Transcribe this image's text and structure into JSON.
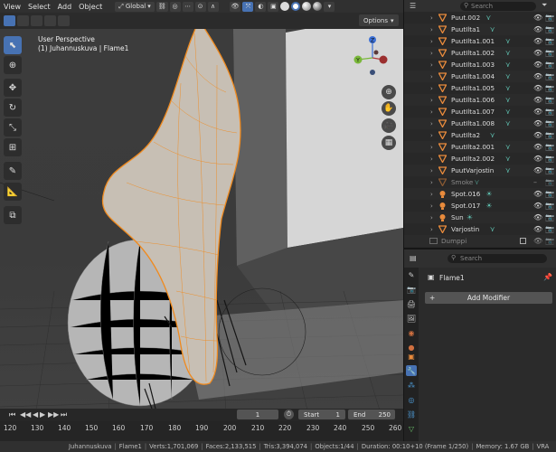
{
  "header": {
    "menus": [
      "View",
      "Select",
      "Add",
      "Object"
    ],
    "orientation": "Global",
    "options_label": "Options"
  },
  "viewport": {
    "perspective": "User Perspective",
    "context": "(1) Juhannuskuva | Flame1",
    "gizmo": {
      "z": "Z",
      "y": "Y"
    }
  },
  "outliner": {
    "search_placeholder": "Search",
    "rows": [
      {
        "name": "Puut.002",
        "type": "mesh",
        "mod": true
      },
      {
        "name": "PuutIlta1",
        "type": "mesh",
        "mod": true
      },
      {
        "name": "PuutIlta1.001",
        "type": "mesh",
        "mod": true
      },
      {
        "name": "PuutIlta1.002",
        "type": "mesh",
        "mod": true
      },
      {
        "name": "PuutIlta1.003",
        "type": "mesh",
        "mod": true
      },
      {
        "name": "PuutIlta1.004",
        "type": "mesh",
        "mod": true
      },
      {
        "name": "PuutIlta1.005",
        "type": "mesh",
        "mod": true
      },
      {
        "name": "PuutIlta1.006",
        "type": "mesh",
        "mod": true
      },
      {
        "name": "PuutIlta1.007",
        "type": "mesh",
        "mod": true
      },
      {
        "name": "PuutIlta1.008",
        "type": "mesh",
        "mod": true
      },
      {
        "name": "PuutIlta2",
        "type": "mesh",
        "mod": true
      },
      {
        "name": "PuutIlta2.001",
        "type": "mesh",
        "mod": true
      },
      {
        "name": "PuutIlta2.002",
        "type": "mesh",
        "mod": true
      },
      {
        "name": "PuutVarjostin",
        "type": "mesh",
        "mod": true
      },
      {
        "name": "Smoke",
        "type": "mesh",
        "mod": true,
        "dim": true
      },
      {
        "name": "Spot.016",
        "type": "light",
        "mod": true
      },
      {
        "name": "Spot.017",
        "type": "light",
        "mod": true
      },
      {
        "name": "Sun",
        "type": "light",
        "mod": true
      },
      {
        "name": "Varjostin",
        "type": "mesh",
        "mod": true
      },
      {
        "name": "Dumppi",
        "type": "collection",
        "mod": false,
        "dim": true
      }
    ]
  },
  "properties": {
    "search_placeholder": "Search",
    "object_name": "Flame1",
    "add_modifier_label": "Add Modifier"
  },
  "timeline": {
    "current_frame": "1",
    "start_label": "Start",
    "start_value": "1",
    "end_label": "End",
    "end_value": "250",
    "ticks": [
      "120",
      "130",
      "140",
      "150",
      "160",
      "170",
      "180",
      "190",
      "200",
      "210",
      "220",
      "230",
      "240",
      "250",
      "260"
    ]
  },
  "status": {
    "items": [
      "Juhannuskuva",
      "Flame1",
      "Verts:1,701,069",
      "Faces:2,133,515",
      "Tris:3,394,074",
      "Objects:1/44",
      "Duration: 00:10+10 (Frame 1/250)",
      "Memory: 1.67 GB",
      "VRA"
    ]
  },
  "colors": {
    "accent": "#4772b3",
    "selection_orange": "#f08a1e",
    "modifier_teal": "#5fc0b0",
    "mesh_orange": "#e98b3c"
  }
}
